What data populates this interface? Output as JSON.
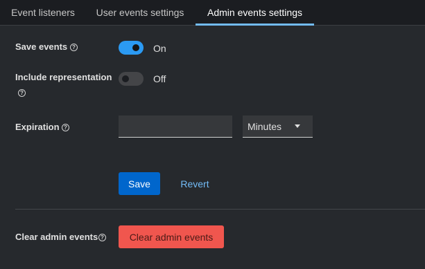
{
  "tabs": [
    {
      "label": "Event listeners",
      "active": false
    },
    {
      "label": "User events settings",
      "active": false
    },
    {
      "label": "Admin events settings",
      "active": true
    }
  ],
  "form": {
    "save_events": {
      "label": "Save events",
      "help_icon": "help-circle-icon",
      "state_text": "On",
      "enabled": true
    },
    "include_representation": {
      "label": "Include representation",
      "help_icon": "help-circle-icon",
      "state_text": "Off",
      "enabled": false
    },
    "expiration": {
      "label": "Expiration",
      "help_icon": "help-circle-icon",
      "value": "",
      "unit": "Minutes"
    },
    "save_label": "Save",
    "revert_label": "Revert"
  },
  "clear": {
    "label": "Clear admin events",
    "help_icon": "help-circle-icon",
    "button_label": "Clear admin events"
  },
  "colors": {
    "accent": "#73bcf7",
    "primary": "#0066cc",
    "danger": "#f0564e",
    "switch_on": "#2b9af3"
  }
}
